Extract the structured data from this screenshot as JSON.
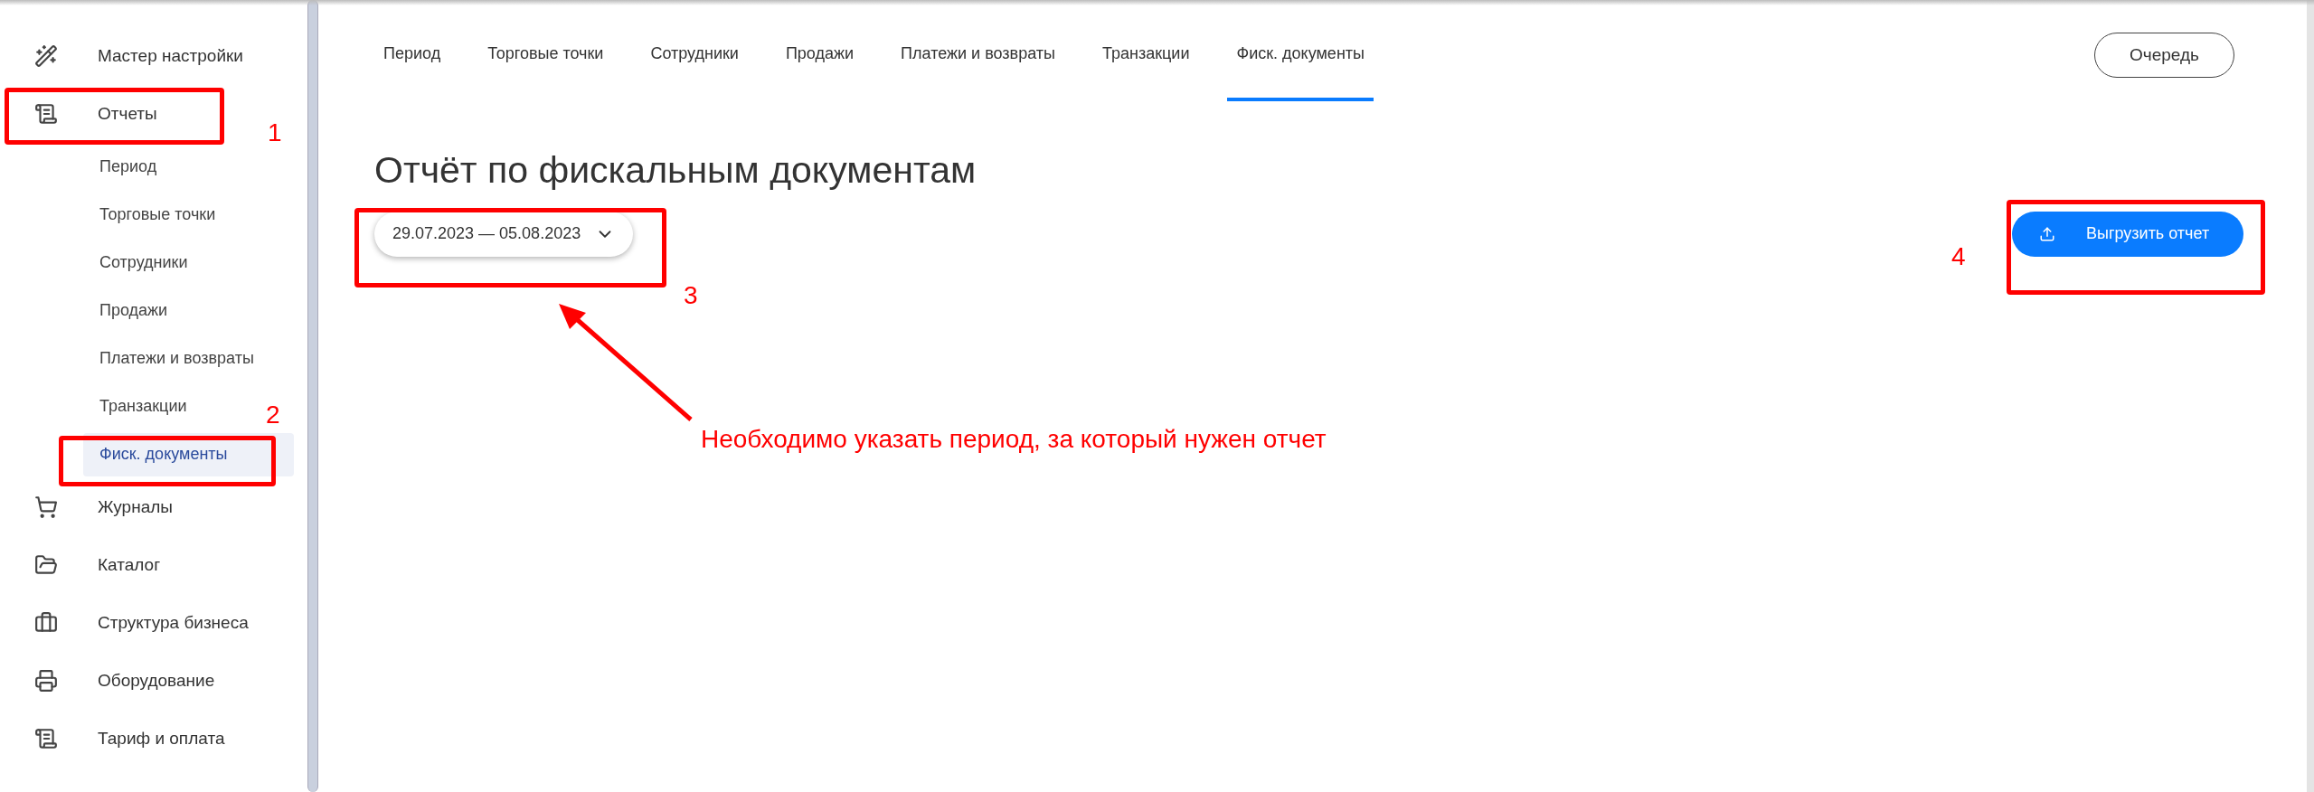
{
  "sidebar": {
    "items": [
      {
        "label": "Мастер настройки",
        "selected": false
      },
      {
        "label": "Отчеты",
        "selected": false,
        "expanded": true,
        "children": [
          {
            "label": "Период",
            "selected": false
          },
          {
            "label": "Торговые точки",
            "selected": false
          },
          {
            "label": "Сотрудники",
            "selected": false
          },
          {
            "label": "Продажи",
            "selected": false
          },
          {
            "label": "Платежи и возвраты",
            "selected": false
          },
          {
            "label": "Транзакции",
            "selected": false
          },
          {
            "label": "Фиск. документы",
            "selected": true
          }
        ]
      },
      {
        "label": "Журналы",
        "selected": false
      },
      {
        "label": "Каталог",
        "selected": false
      },
      {
        "label": "Структура бизнеса",
        "selected": false
      },
      {
        "label": "Оборудование",
        "selected": false
      },
      {
        "label": "Тариф и оплата",
        "selected": false
      }
    ]
  },
  "tabs": [
    {
      "label": "Период",
      "selected": false
    },
    {
      "label": "Торговые точки",
      "selected": false
    },
    {
      "label": "Сотрудники",
      "selected": false
    },
    {
      "label": "Продажи",
      "selected": false
    },
    {
      "label": "Платежи и возвраты",
      "selected": false
    },
    {
      "label": "Транзакции",
      "selected": false
    },
    {
      "label": "Фиск. документы",
      "selected": true
    }
  ],
  "queue_button": "Очередь",
  "title": "Отчёт по фискальным документам",
  "date_range": "29.07.2023 — 05.08.2023",
  "export_button": "Выгрузить отчет",
  "annotations": {
    "markers": [
      "1",
      "2",
      "3",
      "4"
    ],
    "note": "Необходимо указать период, за который нужен отчет"
  }
}
